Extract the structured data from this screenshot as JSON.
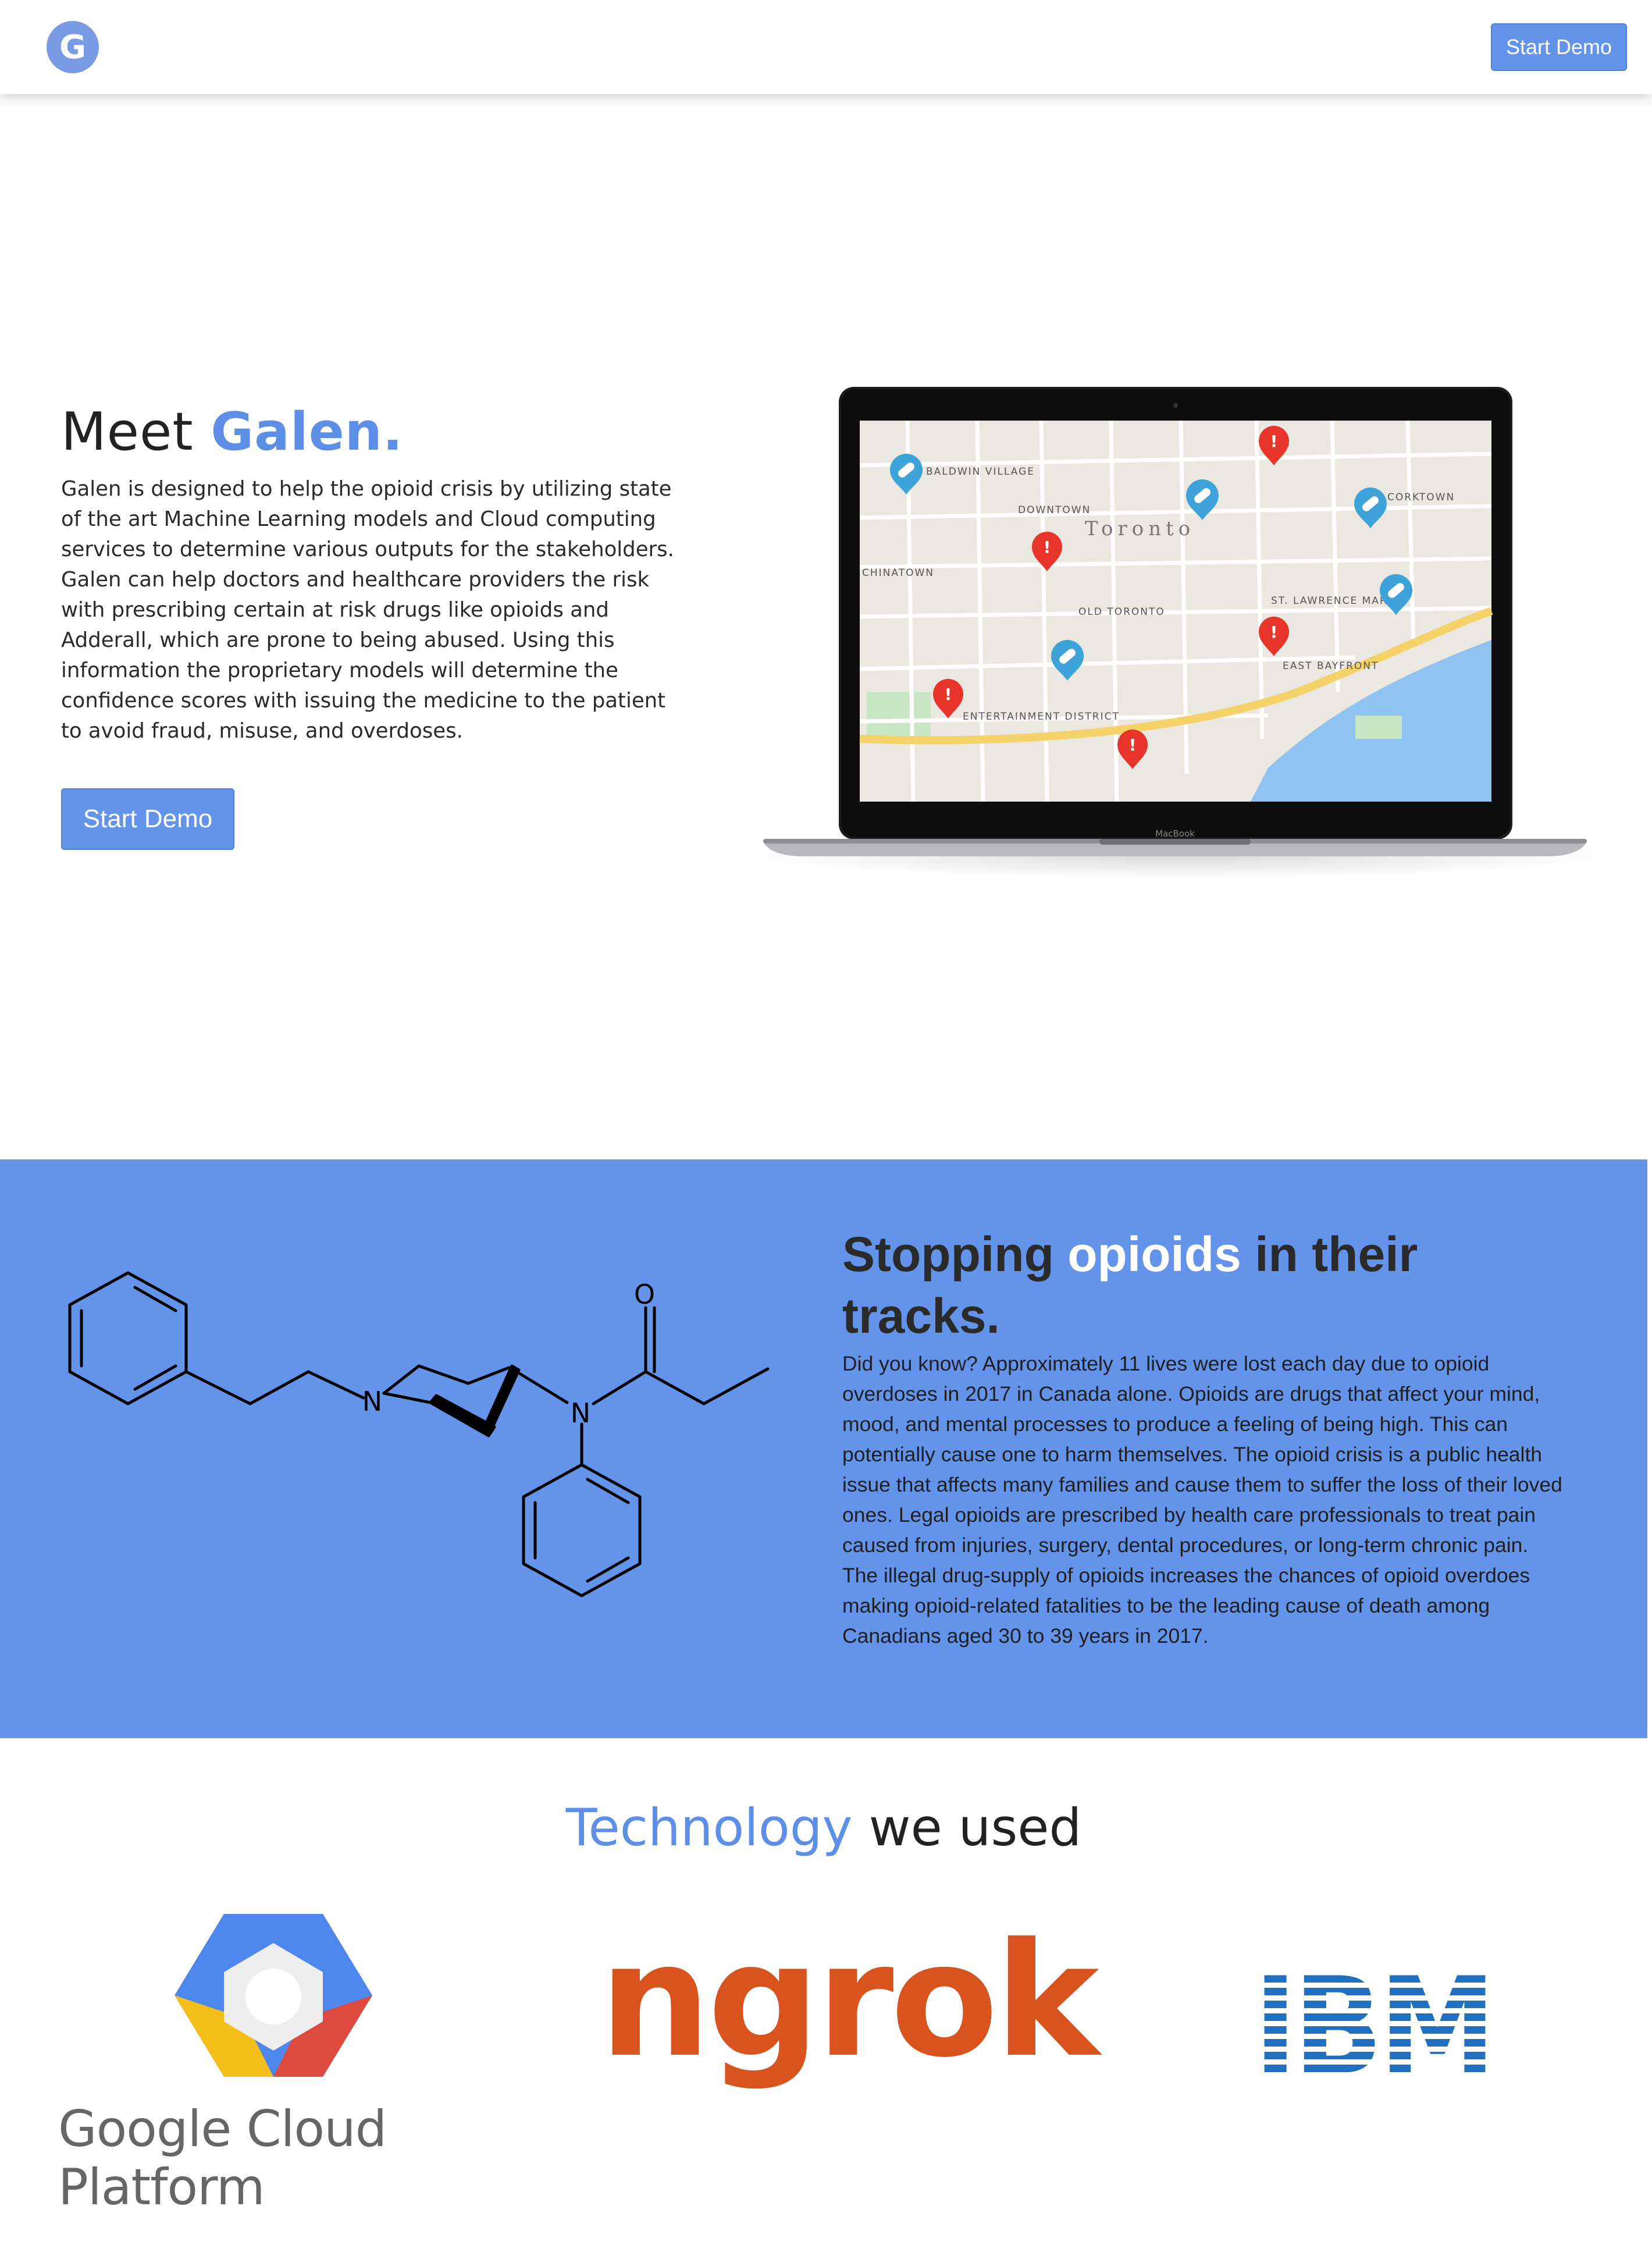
{
  "nav": {
    "logo_letter": "G",
    "demo_label": "Start Demo"
  },
  "hero": {
    "title_prefix": "Meet ",
    "title_accent": "Galen.",
    "body": "Galen is designed to help the opioid crisis by utilizing state of the art Machine Learning models and Cloud computing services to determine various outputs for the stakeholders. Galen can help doctors and healthcare providers the risk with prescribing certain at risk drugs like opioids and Adderall, which are prone to being abused. Using this information the proprietary models will determine the confidence scores with issuing the medicine to the patient to avoid fraud, misuse, and overdoses.",
    "demo_label": "Start Demo",
    "laptop_brand": "MacBook",
    "map": {
      "city": "Toronto",
      "labels": [
        "BALDWIN VILLAGE",
        "DOWNTOWN",
        "CHINATOWN",
        "OLD TORONTO",
        "EAST BAYFRONT",
        "ENTERTAINMENT DISTRICT",
        "CORKTOWN",
        "ST. LAWRENCE MARKET"
      ]
    }
  },
  "opioid": {
    "title_prefix": "Stopping ",
    "title_accent": "opioids",
    "title_suffix": " in their tracks.",
    "body": "Did you know? Approximately 11 lives were lost each day due to opioid overdoses in 2017 in Canada alone. Opioids are drugs that affect your mind, mood, and mental processes to produce a feeling of being high. This can potentially cause one to harm themselves. The opioid crisis is a public health issue that affects many families and cause them to suffer the loss of their loved ones. Legal opioids are prescribed by health care professionals to treat pain caused from injuries, surgery, dental procedures, or long-term chronic pain. The illegal drug-supply of opioids increases the chances of opioid overdoes making opioid-related fatalities to be the leading cause of death among Canadians aged 30 to 39 years in 2017.",
    "atom_n": "N",
    "atom_o": "O"
  },
  "tech": {
    "title_accent": "Technology",
    "title_suffix": " we used",
    "logos": {
      "gcp": "Google Cloud Platform",
      "ngrok": "ngrok",
      "ibm": "IBM"
    }
  },
  "colors": {
    "accent": "#6394ea",
    "accent_text": "#5e8fe6",
    "ngrok": "#d9531e",
    "ibm": "#1f70c1"
  }
}
